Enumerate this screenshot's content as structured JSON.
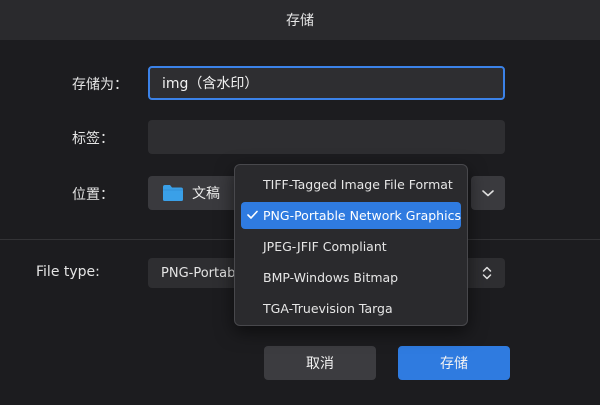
{
  "dialog": {
    "title": "存储",
    "save_as_label": "存储为：",
    "filename": "img（含水印）",
    "tags_label": "标签：",
    "tags_value": "",
    "location_label": "位置：",
    "location_value": "文稿",
    "filetype_label": "File type:",
    "filetype_value": "PNG-Portabl",
    "cancel_label": "取消",
    "save_label": "存储"
  },
  "format_menu": {
    "items": [
      {
        "label": "TIFF-Tagged Image File Format",
        "selected": false
      },
      {
        "label": "PNG-Portable Network Graphics",
        "selected": true
      },
      {
        "label": "JPEG-JFIF Compliant",
        "selected": false
      },
      {
        "label": "BMP-Windows Bitmap",
        "selected": false
      },
      {
        "label": "TGA-Truevision Targa",
        "selected": false
      }
    ]
  },
  "colors": {
    "accent": "#2f7be0",
    "folder": "#3aa0e8"
  },
  "icons": {
    "folder": "folder-icon",
    "expand": "chevron-down-icon",
    "stepper": "chevron-updown-icon",
    "check": "checkmark-icon"
  }
}
